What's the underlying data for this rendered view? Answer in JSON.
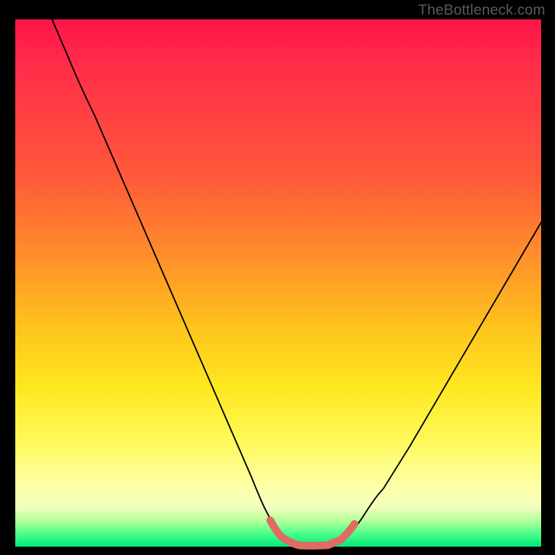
{
  "watermark": "TheBottleneck.com",
  "chart_data": {
    "type": "line",
    "title": "",
    "xlabel": "",
    "ylabel": "",
    "xlim": [
      0,
      100
    ],
    "ylim": [
      0,
      100
    ],
    "grid": false,
    "legend": false,
    "gradient_colors": {
      "top": "#ff1449",
      "mid_upper": "#ff8f2a",
      "mid": "#ffe821",
      "lower": "#feffa8",
      "bottom": "#00e77a"
    },
    "series": [
      {
        "name": "bottleneck-curve",
        "color": "#000000",
        "x": [
          7,
          10,
          15,
          20,
          25,
          30,
          35,
          40,
          45,
          48,
          51,
          55,
          58,
          60,
          63,
          66,
          70,
          75,
          80,
          85,
          90,
          95,
          100
        ],
        "y": [
          100,
          93,
          82,
          70.5,
          59,
          47.5,
          36,
          24.5,
          13,
          6.2,
          2.0,
          0.3,
          0.2,
          0.25,
          1.8,
          5.5,
          11,
          19,
          27.5,
          36,
          44.5,
          53,
          61.5
        ]
      },
      {
        "name": "highlight-band",
        "color": "#e26a62",
        "note": "thick segment marking the near-zero bottleneck range",
        "x": [
          48.5,
          51,
          54,
          57,
          59.5,
          62,
          64.5
        ],
        "y": [
          5.0,
          1.6,
          0.25,
          0.2,
          0.3,
          1.4,
          4.3
        ]
      }
    ]
  }
}
